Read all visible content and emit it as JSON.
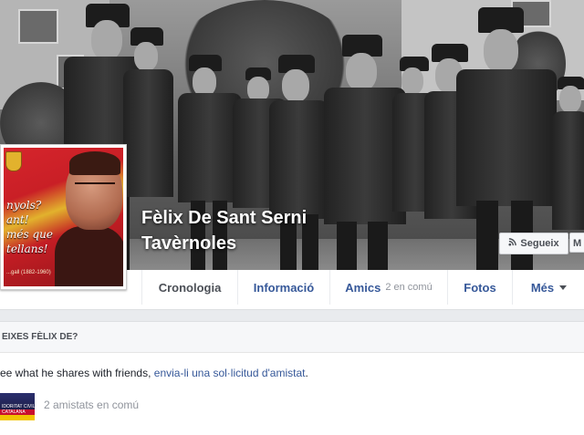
{
  "profile": {
    "name_line1": "Fèlix De Sant Serni",
    "name_line2": "Tavèrnoles",
    "picture_text": [
      "nyols?",
      "ant!",
      "més que",
      "tellans!"
    ],
    "picture_small_text": "...gall (1882-1960)"
  },
  "actions": {
    "follow_label": "Segueix",
    "message_label": "M"
  },
  "tabs": [
    {
      "label": "Cronologia",
      "active": true
    },
    {
      "label": "Informació"
    },
    {
      "label": "Amics",
      "sub": "2 en comú"
    },
    {
      "label": "Fotos"
    },
    {
      "label": "Més"
    }
  ],
  "suggestion": {
    "heading": "EIXES FÈLIX DE?",
    "text_prefix": "ee what he shares with friends, ",
    "link_text": "envia-li una sol·licitud d'amistat",
    "text_suffix": ".",
    "mutual_friends": "2 amistats en comú",
    "mutual_thumb_text": [
      "IDORITAT CIVIL",
      "CATALANA"
    ]
  },
  "icons": {
    "follow": "rss-icon",
    "more": "caret-down-icon"
  },
  "colors": {
    "link": "#365899",
    "muted": "#90949c",
    "page_bg": "#e9ebee"
  }
}
